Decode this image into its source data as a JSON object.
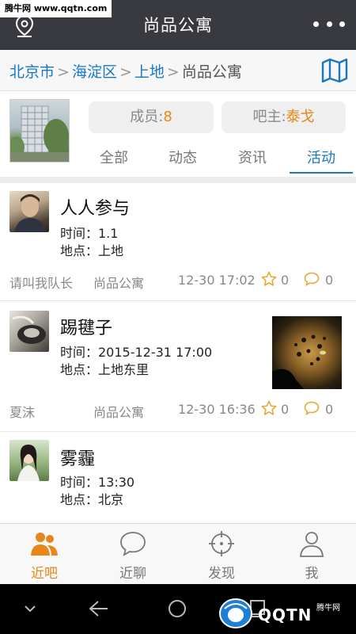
{
  "watermark_top": "腾牛网 www.qqtn.com",
  "header": {
    "title": "尚品公寓"
  },
  "breadcrumb": {
    "items": [
      "北京市",
      "海淀区",
      "上地"
    ],
    "current": "尚品公寓",
    "separator": ">"
  },
  "group": {
    "members_label": "成员:",
    "members_value": "8",
    "owner_label": "吧主:",
    "owner_value": "泰戈"
  },
  "tabs": [
    {
      "label": "全部",
      "active": false
    },
    {
      "label": "动态",
      "active": false
    },
    {
      "label": "资讯",
      "active": false
    },
    {
      "label": "活动",
      "active": true
    }
  ],
  "posts": [
    {
      "title": "人人参与",
      "time_line": "时间：1.1",
      "place_line": "地点：上地",
      "author": "请叫我队长",
      "group": "尚品公寓",
      "timestamp": "12-30 17:02",
      "likes": "0",
      "comments": "0"
    },
    {
      "title": "踢毽子",
      "time_line": "时间：2015-12-31 17:00",
      "place_line": "地点：上地东里",
      "author": "夏沫",
      "group": "尚品公寓",
      "timestamp": "12-30 16:36",
      "likes": "0",
      "comments": "0"
    },
    {
      "title": "雾霾",
      "time_line": "时间：13:30",
      "place_line": "地点：北京"
    }
  ],
  "nav": [
    {
      "label": "近吧",
      "icon": "people-icon",
      "active": true
    },
    {
      "label": "近聊",
      "icon": "chat-bubble-icon",
      "active": false
    },
    {
      "label": "发现",
      "icon": "crosshair-icon",
      "active": false
    },
    {
      "label": "我",
      "icon": "person-icon",
      "active": false
    }
  ],
  "watermark_bottom": {
    "brand": "QQTN",
    "small": "腾牛网"
  },
  "colors": {
    "accent": "#e8861a",
    "link": "#1a78c2",
    "titlebar": "#393a3f"
  }
}
